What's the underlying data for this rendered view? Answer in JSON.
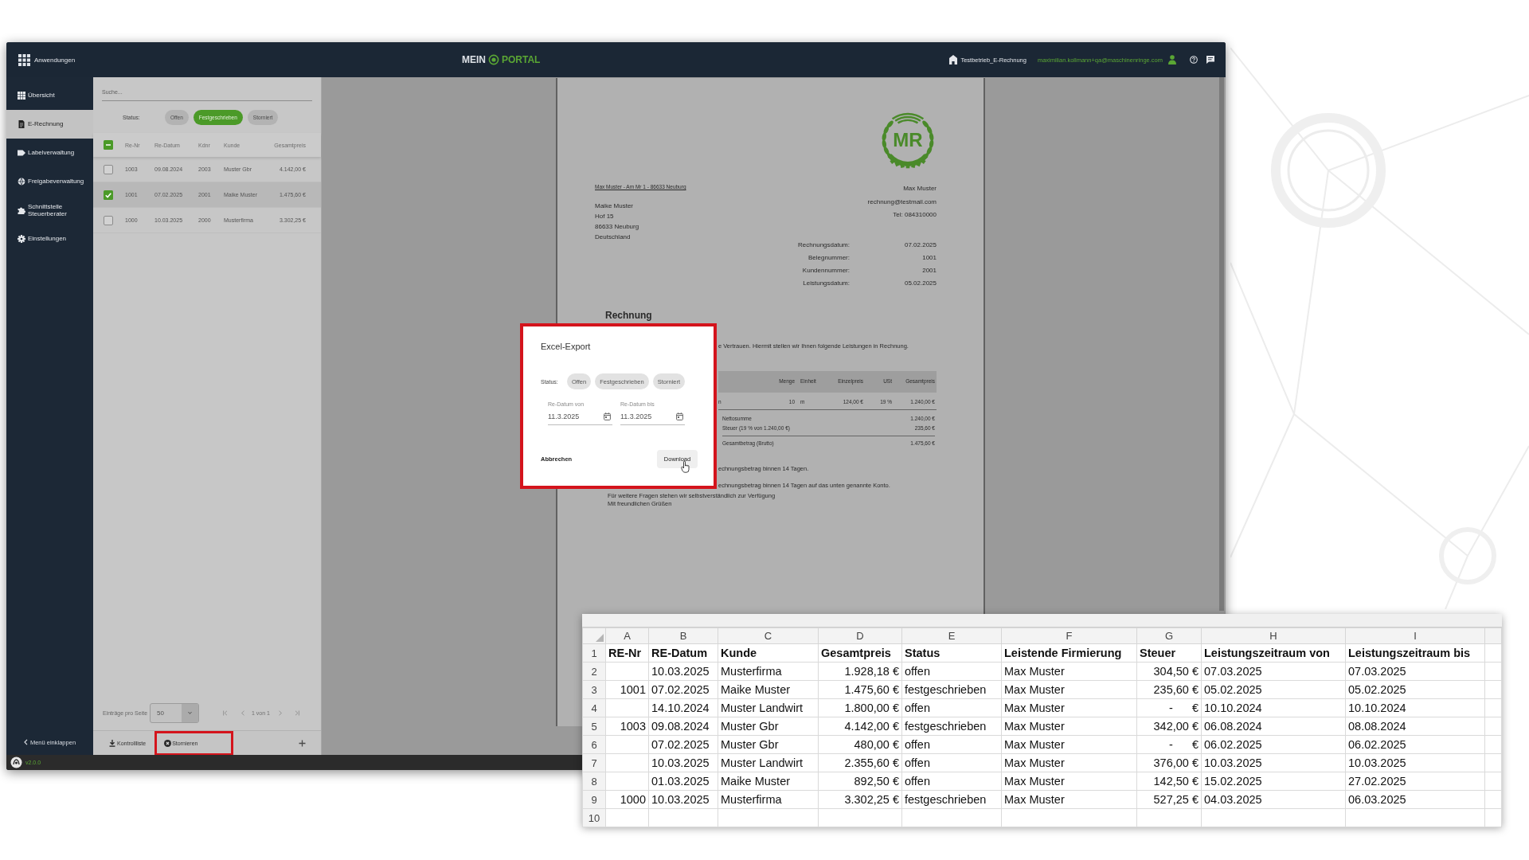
{
  "window": {
    "apps_label": "Anwendungen",
    "logo_words": [
      "MEIN",
      "PORTAL"
    ],
    "company": "Testbetrieb_E-Rechnung",
    "user_email": "maximilian.kollmann+qa@maschinenringe.com",
    "version": "v2.0.0"
  },
  "sidebar": {
    "items": [
      {
        "label": "Übersicht",
        "selected": false
      },
      {
        "label": "E-Rechnung",
        "selected": true
      },
      {
        "label": "Labelverwaltung",
        "selected": false
      },
      {
        "label": "Freigabeverwaltung",
        "selected": false
      },
      {
        "label": "Schnittstelle Steuerberater",
        "selected": false
      },
      {
        "label": "Einstellungen",
        "selected": false
      }
    ],
    "collapse_label": "Menü einklappen"
  },
  "invoice_list": {
    "search": {
      "placeholder": "Suche..."
    },
    "status_label": "Status:",
    "status_filters": [
      {
        "label": "Offen",
        "selected": false
      },
      {
        "label": "Festgeschrieben",
        "selected": true
      },
      {
        "label": "Storniert",
        "selected": false
      }
    ],
    "header_checkbox": {
      "indeterminate": true
    },
    "columns": [
      "Re-Nr",
      "Re-Datum",
      "Kdnr",
      "Kunde",
      "Gesamtpreis"
    ],
    "rows": [
      {
        "checked": false,
        "selected": false,
        "cells": [
          "1003",
          "09.08.2024",
          "2003",
          "Muster Gbr",
          "4.142,00 €"
        ]
      },
      {
        "checked": true,
        "selected": true,
        "cells": [
          "1001",
          "07.02.2025",
          "2001",
          "Maike Muster",
          "1.475,60 €"
        ]
      },
      {
        "checked": false,
        "selected": false,
        "cells": [
          "1000",
          "10.03.2025",
          "2000",
          "Musterfirma",
          "3.302,25 €"
        ]
      }
    ],
    "page_size_label": "Einträge pro Seite",
    "page_size": "50",
    "page_info": "1 von 1",
    "actions": [
      {
        "label": "Kontrollliste",
        "highlighted": false
      },
      {
        "label": "Stornieren",
        "highlighted": true
      }
    ]
  },
  "document": {
    "logo_text": "MR",
    "sender_line": "Max Muster - Am Mr 1 - 86633 Neuburg",
    "recipient": [
      "Maike Muster",
      "Hof 15",
      "86633 Neuburg",
      "Deutschland"
    ],
    "issuer": [
      "Max Muster",
      "rechnung@testmail.com",
      "Tel: 084310000"
    ],
    "details": [
      {
        "label": "Rechnungsdatum:",
        "value": "07.02.2025"
      },
      {
        "label": "Belegnummer:",
        "value": "1001"
      },
      {
        "label": "Kundennummer:",
        "value": "2001"
      },
      {
        "label": "Leistungsdatum:",
        "value": "05.02.2025"
      }
    ],
    "title": "Rechnung",
    "intro": "e Vertrauen. Hiermit stellen wir Ihnen folgende Leistungen in Rechnung.",
    "items_table": {
      "columns": [
        "Menge",
        "Einheit",
        "Einzelpreis",
        "USt",
        "Gesamtpreis"
      ],
      "rows": [
        {
          "description": "n",
          "cells": [
            "10",
            "m",
            "124,00 €",
            "19 %",
            "1.240,00 €"
          ]
        }
      ],
      "totals": [
        {
          "label": "Nettosumme",
          "value": "1.240,00 €"
        },
        {
          "label": "Steuer (19 % von 1.240,00 €)",
          "value": "235,60 €"
        },
        {
          "label": "Gesamtbetrag (Brutto)",
          "value": "1.475,60 €"
        }
      ]
    },
    "payment_lines": [
      "echnungsbetrag binnen 14 Tagen.",
      "echnungsbetrag binnen 14 Tagen auf das unten genannte Konto."
    ],
    "closing_lines": [
      "Für weitere Fragen stehen wir selbstverständlich zur Verfügung",
      "Mit freundlichen Grüßen"
    ]
  },
  "export_dialog": {
    "highlighted": true,
    "title": "Excel-Export",
    "status_label": "Status:",
    "status_filters": [
      {
        "label": "Offen",
        "selected": false
      },
      {
        "label": "Festgeschrieben",
        "selected": false
      },
      {
        "label": "Storniert",
        "selected": false
      }
    ],
    "date_fields": [
      {
        "label": "Re-Datum von",
        "value": "11.3.2025"
      },
      {
        "label": "Re-Datum bis",
        "value": "11.3.2025"
      }
    ],
    "cancel_button": "Abbrechen",
    "download_button": "Download"
  },
  "spreadsheet": {
    "columns": [
      {
        "letter": "A",
        "kind": "number"
      },
      {
        "letter": "B",
        "kind": "text"
      },
      {
        "letter": "C",
        "kind": "text"
      },
      {
        "letter": "D",
        "kind": "number"
      },
      {
        "letter": "E",
        "kind": "text"
      },
      {
        "letter": "F",
        "kind": "text"
      },
      {
        "letter": "G",
        "kind": "number"
      },
      {
        "letter": "H",
        "kind": "text"
      },
      {
        "letter": "I",
        "kind": "text"
      }
    ],
    "rows": [
      {
        "number": "1",
        "kind": "header",
        "cells": [
          "RE-Nr",
          "RE-Datum",
          "Kunde",
          "Gesamtpreis",
          "Status",
          "Leistende Firmierung",
          "Steuer",
          "Leistungszeitraum von",
          "Leistungszeitraum bis"
        ]
      },
      {
        "number": "2",
        "kind": "data",
        "cells": [
          null,
          "10.03.2025",
          "Musterfirma",
          "1.928,18 €",
          "offen",
          "Max Muster",
          "304,50 €",
          "07.03.2025",
          "07.03.2025"
        ]
      },
      {
        "number": "3",
        "kind": "data",
        "cells": [
          "1001",
          "07.02.2025",
          "Maike Muster",
          "1.475,60 €",
          "festgeschrieben",
          "Max Muster",
          "235,60 €",
          "05.02.2025",
          "05.02.2025"
        ]
      },
      {
        "number": "4",
        "kind": "data",
        "cells": [
          null,
          "14.10.2024",
          "Muster Landwirt",
          "1.800,00 €",
          "offen",
          "Max Muster",
          "-      €",
          "10.10.2024",
          "10.10.2024"
        ]
      },
      {
        "number": "5",
        "kind": "data",
        "cells": [
          "1003",
          "09.08.2024",
          "Muster Gbr",
          "4.142,00 €",
          "festgeschrieben",
          "Max Muster",
          "342,00 €",
          "06.08.2024",
          "08.08.2024"
        ]
      },
      {
        "number": "6",
        "kind": "data",
        "cells": [
          null,
          "07.02.2025",
          "Muster Gbr",
          "480,00 €",
          "offen",
          "Max Muster",
          "-      €",
          "06.02.2025",
          "06.02.2025"
        ]
      },
      {
        "number": "7",
        "kind": "data",
        "cells": [
          null,
          "10.03.2025",
          "Muster Landwirt",
          "2.355,60 €",
          "offen",
          "Max Muster",
          "376,00 €",
          "10.03.2025",
          "10.03.2025"
        ]
      },
      {
        "number": "8",
        "kind": "data",
        "cells": [
          null,
          "01.03.2025",
          "Maike Muster",
          "892,50 €",
          "offen",
          "Max Muster",
          "142,50 €",
          "15.02.2025",
          "27.02.2025"
        ]
      },
      {
        "number": "9",
        "kind": "data",
        "cells": [
          "1000",
          "10.03.2025",
          "Musterfirma",
          "3.302,25 €",
          "festgeschrieben",
          "Max Muster",
          "527,25 €",
          "04.03.2025",
          "06.03.2025"
        ]
      },
      {
        "number": "10",
        "kind": "data"
      }
    ]
  }
}
